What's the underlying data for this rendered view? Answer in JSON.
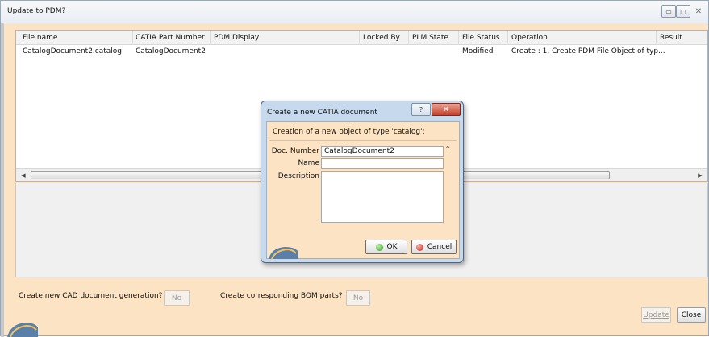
{
  "window": {
    "title": "Update to PDM?",
    "controls": {
      "minimize": "▭",
      "maximize": "▢",
      "close": "✕"
    }
  },
  "table": {
    "columns": [
      "File name",
      "CATIA Part Number",
      "PDM Display",
      "Locked By",
      "PLM State",
      "File Status",
      "Operation",
      "Result"
    ],
    "rows": [
      [
        "CatalogDocument2.catalog",
        "CatalogDocument2",
        "",
        "",
        "",
        "Modified",
        "Create : 1. Create PDM File Object of typ...",
        ""
      ]
    ]
  },
  "bottom": {
    "cad_label": "Create new CAD document generation?",
    "cad_value": "No",
    "bom_label": "Create corresponding BOM parts?",
    "bom_value": "No",
    "update_label": "Update",
    "close_label": "Close"
  },
  "dialog": {
    "title": "Create a new CATIA document",
    "help": "?",
    "close": "✕",
    "message": "Creation of a new object of type 'catalog':",
    "doc_number_label": "Doc. Number",
    "doc_number_value": "CatalogDocument2",
    "required_mark": "*",
    "name_label": "Name",
    "name_value": "",
    "description_label": "Description",
    "ok_label": "OK",
    "cancel_label": "Cancel"
  }
}
